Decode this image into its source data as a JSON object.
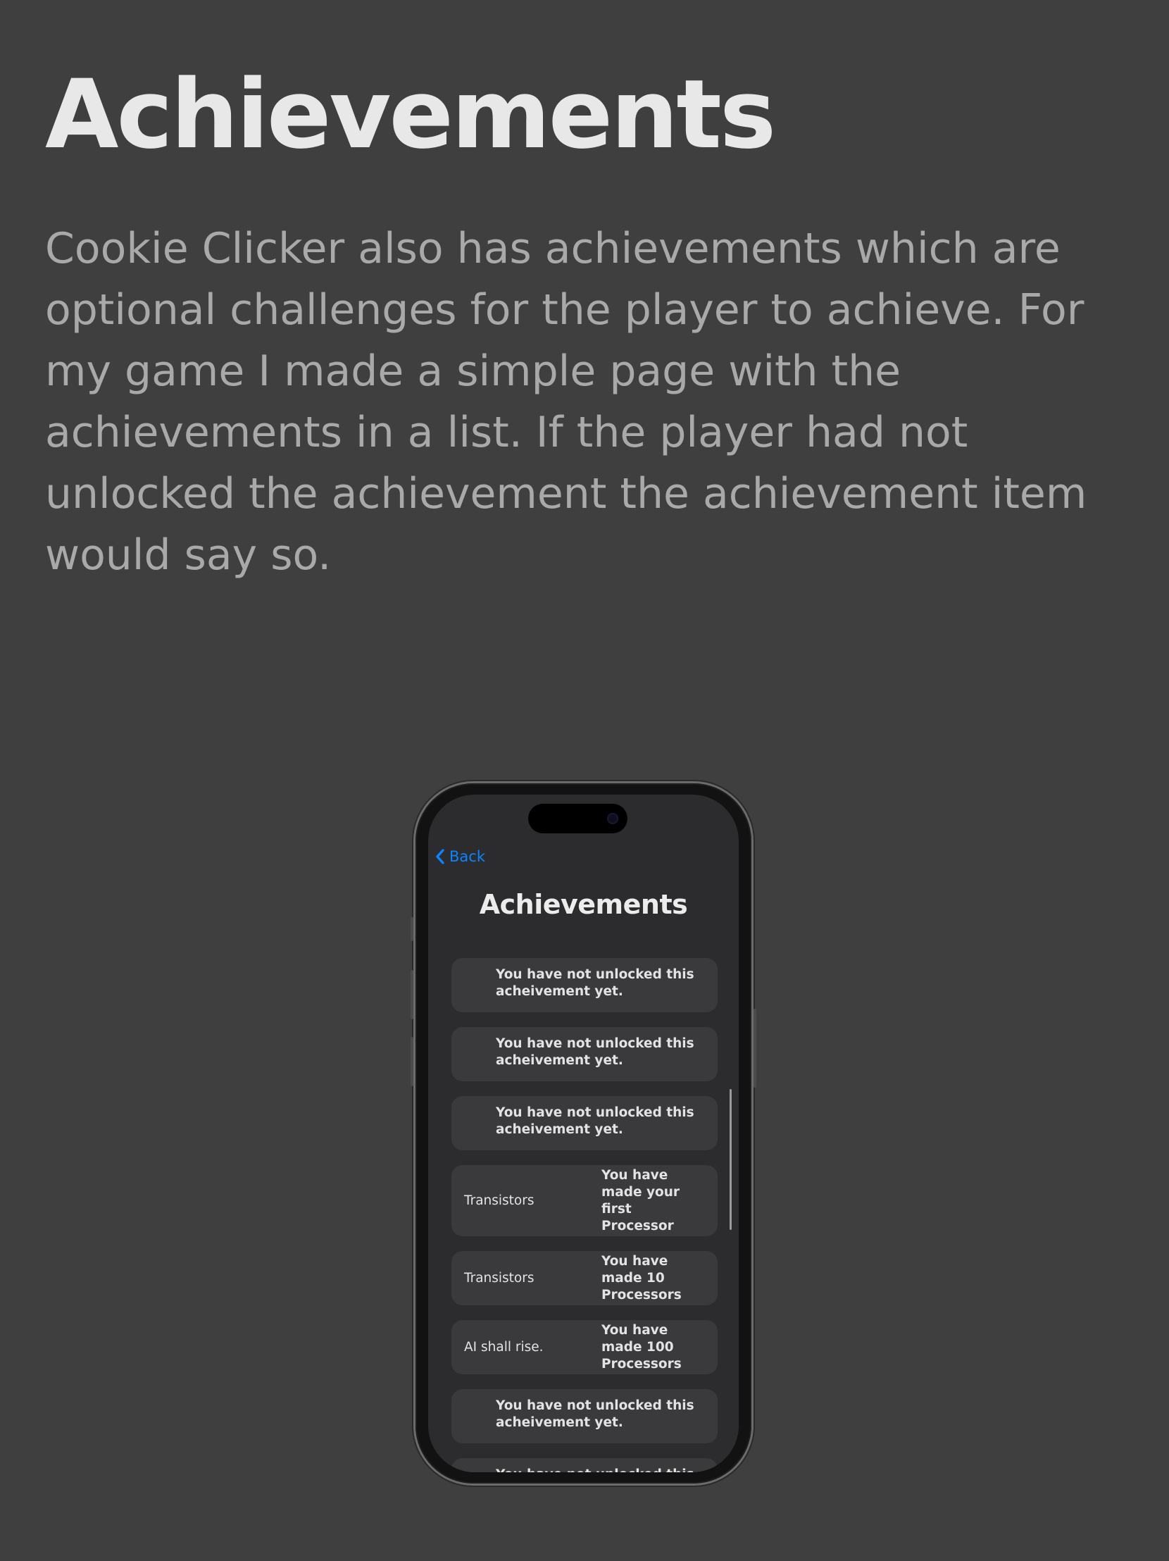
{
  "section": {
    "heading": "Achievements",
    "paragraph": "Cookie Clicker also has achievements which are optional challenges for the player to achieve. For my game I made a simple page with the achievements in a list. If the player had not unlocked the achievement the achievement item would say so."
  },
  "phone": {
    "nav": {
      "back_label": "Back",
      "back_icon": "chevron-left-icon",
      "accent_color": "#0a84ff"
    },
    "title": "Achievements",
    "achievements": [
      {
        "name": "",
        "description": "You have not unlocked this acheivement yet."
      },
      {
        "name": "",
        "description": "You have not unlocked this acheivement yet."
      },
      {
        "name": "",
        "description": "You have not unlocked this acheivement yet."
      },
      {
        "name": "Transistors",
        "description": "You have made your first Processor"
      },
      {
        "name": "Transistors",
        "description": "You have made 10 Processors"
      },
      {
        "name": "AI shall rise.",
        "description": "You have made 100 Processors"
      },
      {
        "name": "",
        "description": "You have not unlocked this acheivement yet."
      },
      {
        "name": "",
        "description": "You have not unlocked this"
      }
    ]
  }
}
